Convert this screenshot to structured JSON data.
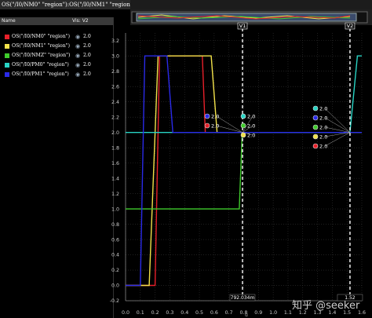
{
  "window": {
    "title": "OS(\"/I0/NM0\" \"region\"):OS(\"/I0/NM1\" \"region\"):OS(\"/I0/NMZ\" \"region\"):OS(\"/I0/PM0\" \"region\"):OS(\"/I0/PM1\" \"region\")"
  },
  "panel": {
    "header_name": "Name",
    "header_value": "Vis: V2",
    "rows": [
      {
        "name": "OS(\"/I0/NM0\" \"region\")",
        "value": "2.0",
        "color": "#e8202a"
      },
      {
        "name": "OS(\"/I0/NM1\" \"region\")",
        "value": "2.0",
        "color": "#f2e24a"
      },
      {
        "name": "OS(\"/I0/NMZ\" \"region\")",
        "value": "2.0",
        "color": "#3fcc2c"
      },
      {
        "name": "OS(\"/I0/PM0\" \"region\")",
        "value": "2.0",
        "color": "#28d4c4"
      },
      {
        "name": "OS(\"/I0/PM1\" \"region\")",
        "value": "2.0",
        "color": "#2a2ae8"
      }
    ]
  },
  "cursor_labels": {
    "v1": "V1",
    "v2": "V2",
    "v1_readout": "792.034m",
    "v2_readout": "1.52"
  },
  "marker_values": {
    "group_a": [
      "2.0",
      "2.0"
    ],
    "group_b": [
      "2.0",
      "2.0",
      "2.0"
    ],
    "group_c": [
      "2.0",
      "2.0",
      "2.0",
      "2.0",
      "2.0"
    ]
  },
  "x_axis_title": "u",
  "watermark": "知乎 @seeker",
  "chart_data": {
    "type": "line",
    "title": "",
    "xlabel": "",
    "ylabel": "",
    "xlim": [
      0.0,
      1.6
    ],
    "ylim": [
      -0.2,
      3.3
    ],
    "x_ticks": [
      "0.0",
      "0.1",
      "0.2",
      "0.3",
      "0.4",
      "0.5",
      "0.6",
      "0.7",
      "0.8",
      "0.9",
      "1.0",
      "1.1",
      "1.2",
      "1.3",
      "1.4",
      "1.5",
      "1.6"
    ],
    "y_ticks": [
      "-0.2",
      "0.0",
      "0.2",
      "0.4",
      "0.6",
      "0.8",
      "1.0",
      "1.2",
      "1.4",
      "1.6",
      "1.8",
      "2.0",
      "2.2",
      "2.4",
      "2.6",
      "2.8",
      "3.0",
      "3.2"
    ],
    "grid": true,
    "cursors": [
      0.792,
      1.52
    ],
    "series": [
      {
        "name": "OS(\"/I0/NM0\" \"region\")",
        "color": "#e8202a",
        "points": [
          [
            0.0,
            0.0
          ],
          [
            0.2,
            0.0
          ],
          [
            0.23,
            3.0
          ],
          [
            0.52,
            3.0
          ],
          [
            0.54,
            2.0
          ],
          [
            1.6,
            2.0
          ]
        ]
      },
      {
        "name": "OS(\"/I0/NM1\" \"region\")",
        "color": "#f2e24a",
        "points": [
          [
            0.0,
            0.0
          ],
          [
            0.16,
            0.0
          ],
          [
            0.22,
            3.0
          ],
          [
            0.58,
            3.0
          ],
          [
            0.62,
            2.0
          ],
          [
            1.6,
            2.0
          ]
        ]
      },
      {
        "name": "OS(\"/I0/NMZ\" \"region\")",
        "color": "#3fcc2c",
        "points": [
          [
            0.0,
            1.0
          ],
          [
            0.77,
            1.0
          ],
          [
            0.79,
            2.0
          ],
          [
            1.6,
            2.0
          ]
        ]
      },
      {
        "name": "OS(\"/I0/PM0\" \"region\")",
        "color": "#28d4c4",
        "points": [
          [
            0.0,
            2.0
          ],
          [
            1.52,
            2.0
          ],
          [
            1.57,
            3.0
          ],
          [
            1.6,
            3.0
          ]
        ]
      },
      {
        "name": "OS(\"/I0/PM1\" \"region\")",
        "color": "#2a2ae8",
        "points": [
          [
            0.0,
            0.0
          ],
          [
            0.1,
            0.0
          ],
          [
            0.13,
            3.0
          ],
          [
            0.28,
            3.0
          ],
          [
            0.32,
            2.0
          ],
          [
            1.6,
            2.0
          ]
        ]
      }
    ]
  }
}
